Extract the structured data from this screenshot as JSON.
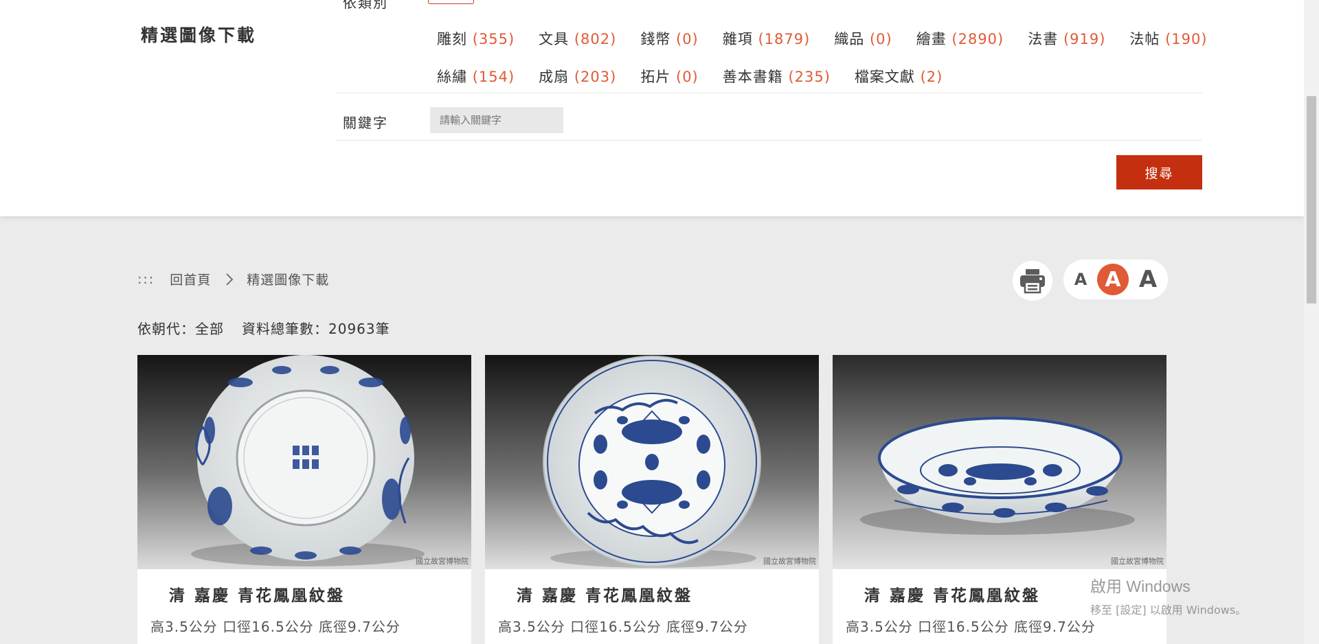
{
  "filter_panel": {
    "title": "精選圖像下載",
    "cut_off_label": "依類別",
    "categories": [
      {
        "name": "雕刻",
        "count": "(355)"
      },
      {
        "name": "文具",
        "count": "(802)"
      },
      {
        "name": "錢幣",
        "count": "(0)"
      },
      {
        "name": "雜項",
        "count": "(1879)"
      },
      {
        "name": "織品",
        "count": "(0)"
      },
      {
        "name": "繪畫",
        "count": "(2890)"
      },
      {
        "name": "法書",
        "count": "(919)"
      },
      {
        "name": "法帖",
        "count": "(190)"
      },
      {
        "name": "絲繡",
        "count": "(154)"
      },
      {
        "name": "成扇",
        "count": "(203)"
      },
      {
        "name": "拓片",
        "count": "(0)"
      },
      {
        "name": "善本書籍",
        "count": "(235)"
      },
      {
        "name": "檔案文獻",
        "count": "(2)"
      }
    ],
    "keyword_label": "關鍵字",
    "keyword_placeholder": "請輸入關鍵字",
    "keyword_value": "",
    "search_label": "搜尋"
  },
  "breadcrumb": {
    "marker": ":::",
    "home": "回首頁",
    "current": "精選圖像下載"
  },
  "tools": {
    "print_icon": "printer-icon",
    "font_sizes": [
      "A",
      "A",
      "A"
    ],
    "active_font_size": 1
  },
  "summary": {
    "dynasty": "依朝代：全部",
    "total": "資料總筆數：20963筆"
  },
  "results": [
    {
      "title": "清 嘉慶 青花鳳凰紋盤",
      "dims": "高3.5公分 口徑16.5公分 底徑9.7公分",
      "watermark": "國立故宮博物院",
      "view": "bottom"
    },
    {
      "title": "清 嘉慶 青花鳳凰紋盤",
      "dims": "高3.5公分 口徑16.5公分 底徑9.7公分",
      "watermark": "國立故宮博物院",
      "view": "top"
    },
    {
      "title": "清 嘉慶 青花鳳凰紋盤",
      "dims": "高3.5公分 口徑16.5公分 底徑9.7公分",
      "watermark": "國立故宮博物院",
      "view": "side"
    }
  ],
  "windows_watermark": {
    "line1": "啟用 Windows",
    "line2": "移至 [設定] 以啟用 Windows。"
  },
  "colors": {
    "accent": "#e05a36",
    "button": "#c4300f",
    "porcelain_blue": "#2c4a8f"
  }
}
